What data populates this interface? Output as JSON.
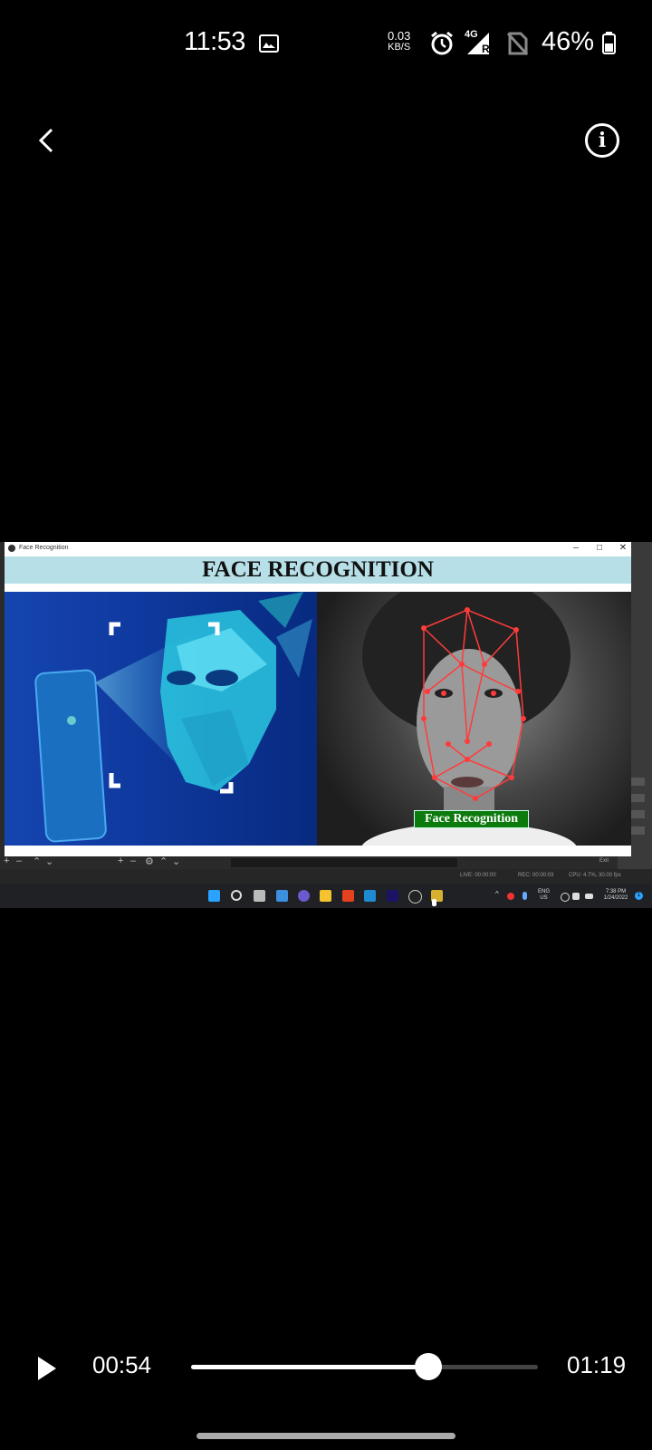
{
  "status_bar": {
    "time": "11:53",
    "net_speed_value": "0.03",
    "net_speed_unit": "KB/S",
    "network_type": "4G",
    "network_sub": "R",
    "battery_percent": "46%"
  },
  "video": {
    "window_title": "Face Recognition",
    "app_heading": "FACE RECOGNITION",
    "overlay_label": "Face Recognition",
    "obs_live": "LIVE: 00:00:00",
    "obs_rec": "REC: 00:00:03",
    "obs_cpu": "CPU: 4.7%, 30.00 fps",
    "exit_label": "Exit",
    "taskbar_lang": "ENG",
    "taskbar_region": "US",
    "taskbar_time": "7:38 PM",
    "taskbar_date": "1/24/2022",
    "notification_count": "1"
  },
  "player": {
    "current_time": "00:54",
    "total_time": "01:19",
    "progress": 0.6835
  },
  "colors": {
    "accent_header": "#b7dfe8",
    "label_green": "#0c7a0c",
    "landmark_red": "#ff3b3b"
  }
}
